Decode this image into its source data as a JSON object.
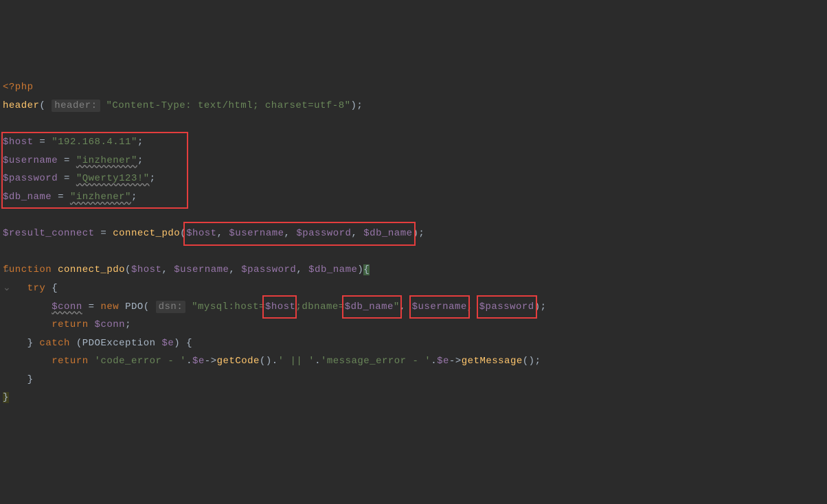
{
  "code": {
    "php_open": "<?php",
    "header_fn": "header",
    "header_hint": "header:",
    "header_arg": "\"Content-Type: text/html; charset=utf-8\"",
    "var_host": "$host",
    "val_host": "\"192.168.4.11\"",
    "var_username": "$username",
    "val_username": "\"inzhener\"",
    "var_password": "$password",
    "val_password": "\"Qwerty123!\"",
    "var_dbname": "$db_name",
    "val_dbname": "\"inzhener\"",
    "var_result": "$result_connect",
    "fn_connect": "connect_pdo",
    "arg_host": "$host",
    "arg_username": "$username",
    "arg_password": "$password",
    "arg_dbname": "$db_name",
    "kw_function": "function",
    "kw_try": "try",
    "kw_catch": "catch",
    "kw_new": "new",
    "kw_return": "return",
    "var_conn": "$conn",
    "cls_pdo": "PDO",
    "dsn_hint": "dsn:",
    "dsn_prefix": "\"mysql:host=",
    "dsn_mid": ";dbname=",
    "dsn_end": "\"",
    "cls_exc": "PDOException",
    "var_e": "$e",
    "str_code_error": "'code_error - '",
    "fn_getcode": "getCode",
    "str_pipe": "' || '",
    "str_msg_error": "'message_error - '",
    "fn_getmsg": "getMessage",
    "brace_open": "{",
    "brace_close": "}",
    "paren_open": "(",
    "paren_close": ")",
    "semi": ";",
    "comma": ",",
    "eq": " = ",
    "dot": ".",
    "arrow": "->"
  }
}
